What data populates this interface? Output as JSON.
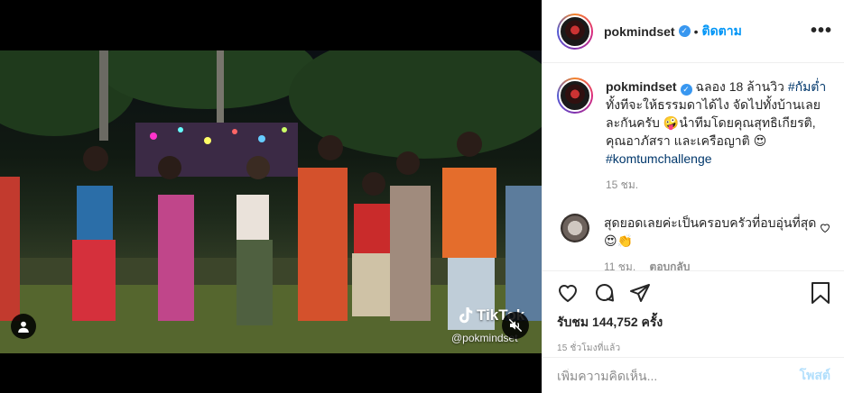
{
  "post": {
    "username": "pokmindset",
    "follow_label": "ติดตาม",
    "dot": "•",
    "more_label": "•••"
  },
  "caption": {
    "username": "pokmindset",
    "text_part1": " ฉลอง 18 ล้านวิว ",
    "hashtag1": "#กัมต่ำ",
    "text_part2": " ทั้งทีจะให้ธรรมดาได้ไง จัดไปทั้งบ้านเลยละกันครับ 🤪นำทีมโดยคุณสุทธิเกียรติ, คุณอาภัสรา และเครือญาติ 😍",
    "hashtag2": "#komtumchallenge",
    "time": "15 ชม."
  },
  "comment": {
    "text": "สุดยอดเลยค่ะเป็นครอบครัวที่อบอุ่นที่สุด😍👏",
    "time": "11 ชม.",
    "reply_label": "ตอบกลับ"
  },
  "stats": {
    "views": "รับชม 144,752 ครั้ง",
    "ago": "15 ชั่วโมงที่แล้ว"
  },
  "composer": {
    "placeholder": "เพิ่มความคิดเห็น...",
    "post_label": "โพสต์"
  },
  "video": {
    "watermark_brand": "TikTok",
    "watermark_user": "@pokmindset"
  },
  "colors": {
    "link": "#0095f6",
    "hashtag": "#00376b",
    "muted": "#8e8e8e",
    "post_disabled": "#b2dffc"
  }
}
